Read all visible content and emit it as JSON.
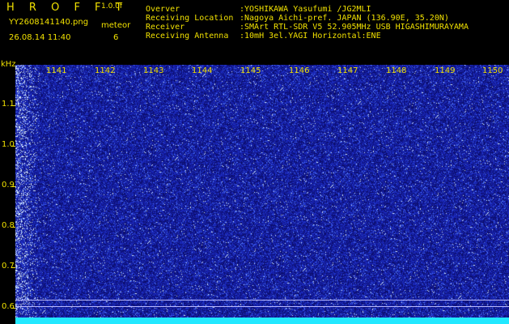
{
  "header": {
    "app_title": "H R O F F T",
    "app_version": "1.0.0f",
    "file_name": "YY2608141140.png",
    "date_time": "26.08.14 11:40",
    "meteor_label": "meteor",
    "meteor_count": "6",
    "info": [
      {
        "key": "Overver",
        "value": ":YOSHIKAWA Yasufumi /JG2MLI"
      },
      {
        "key": "Receiving Location",
        "value": ":Nagoya Aichi-pref. JAPAN (136.90E, 35.20N)"
      },
      {
        "key": "Receiver",
        "value": ":SMArt RTL-SDR V5 52.905MHz USB HIGASHIMURAYAMA"
      },
      {
        "key": "Receiving Antenna",
        "value": ":10mH 3el.YAGI Horizontal:ENE"
      }
    ]
  },
  "y_axis": {
    "unit": "kHz",
    "labels": [
      "1.1",
      "1.0",
      "0.9",
      "0.8",
      "0.7",
      "0.6"
    ]
  },
  "time_axis": {
    "labels": [
      "1141",
      "1142",
      "1143",
      "1144",
      "1145",
      "1146",
      "1147",
      "1148",
      "1149",
      "1150"
    ]
  },
  "colors": {
    "text": "#f0e000",
    "background": "#1a1fa0",
    "floor": "#22e8ff"
  }
}
